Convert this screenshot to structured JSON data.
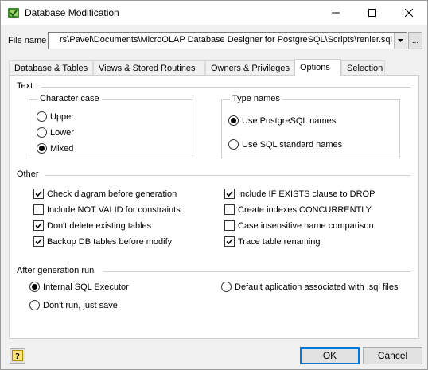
{
  "window": {
    "title": "Database Modification",
    "controls": {
      "minimize_icon": "minimize-icon",
      "maximize_icon": "maximize-icon",
      "close_icon": "close-icon"
    }
  },
  "file": {
    "label": "File name",
    "value": "rs\\Pavel\\Documents\\MicroOLAP Database Designer for PostgreSQL\\Scripts\\renier.sql",
    "browse_label": "..."
  },
  "tabs": [
    {
      "label": "Database & Tables",
      "active": false
    },
    {
      "label": "Views & Stored Routines",
      "active": false
    },
    {
      "label": "Owners & Privileges",
      "active": false
    },
    {
      "label": "Options",
      "active": true
    },
    {
      "label": "Selection",
      "active": false
    }
  ],
  "options": {
    "text_section": "Text",
    "character_case": {
      "title": "Character case",
      "items": [
        {
          "label": "Upper",
          "checked": false
        },
        {
          "label": "Lower",
          "checked": false
        },
        {
          "label": "Mixed",
          "checked": true
        }
      ]
    },
    "type_names": {
      "title": "Type names",
      "items": [
        {
          "label": "Use PostgreSQL names",
          "checked": true
        },
        {
          "label": "Use SQL standard names",
          "checked": false
        }
      ]
    },
    "other_section": "Other",
    "other": {
      "left": [
        {
          "label": "Check diagram before generation",
          "checked": true
        },
        {
          "label": "Include NOT VALID for constraints",
          "checked": false
        },
        {
          "label": "Don't delete existing tables",
          "checked": true
        },
        {
          "label": "Backup DB tables before modify",
          "checked": true
        }
      ],
      "right": [
        {
          "label": "Include IF EXISTS clause to DROP",
          "checked": true
        },
        {
          "label": "Create indexes CONCURRENTLY",
          "checked": false
        },
        {
          "label": "Case insensitive name comparison",
          "checked": false
        },
        {
          "label": "Trace table renaming",
          "checked": true
        }
      ]
    },
    "after_section": "After generation run",
    "after": [
      {
        "label": "Internal SQL Executor",
        "checked": true
      },
      {
        "label": "Default aplication associated with .sql files",
        "checked": false
      },
      {
        "label": "Don't run, just save",
        "checked": false
      }
    ]
  },
  "buttons": {
    "help": "?",
    "ok": "OK",
    "cancel": "Cancel"
  }
}
